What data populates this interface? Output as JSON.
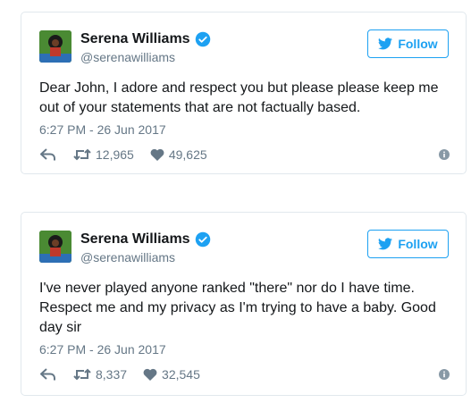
{
  "tweets": [
    {
      "display_name": "Serena Williams",
      "handle": "@serenawilliams",
      "follow_label": "Follow",
      "text": "Dear John, I adore and respect you but please please keep me out of your statements that are not factually based.",
      "timestamp": "6:27 PM - 26 Jun 2017",
      "retweets": "12,965",
      "likes": "49,625"
    },
    {
      "display_name": "Serena Williams",
      "handle": "@serenawilliams",
      "follow_label": "Follow",
      "text": "I've never played anyone ranked \"there\" nor do I have time. Respect me and my privacy as I'm trying to have a baby. Good day sir",
      "timestamp": "6:27 PM - 26 Jun 2017",
      "retweets": "8,337",
      "likes": "32,545"
    }
  ],
  "icons": [
    "verified-badge-icon",
    "twitter-bird-icon",
    "reply-icon",
    "retweet-icon",
    "heart-icon",
    "info-icon"
  ],
  "colors": {
    "accent": "#1da1f2",
    "text": "#14171a",
    "muted": "#657786",
    "border": "#e1e8ed"
  }
}
